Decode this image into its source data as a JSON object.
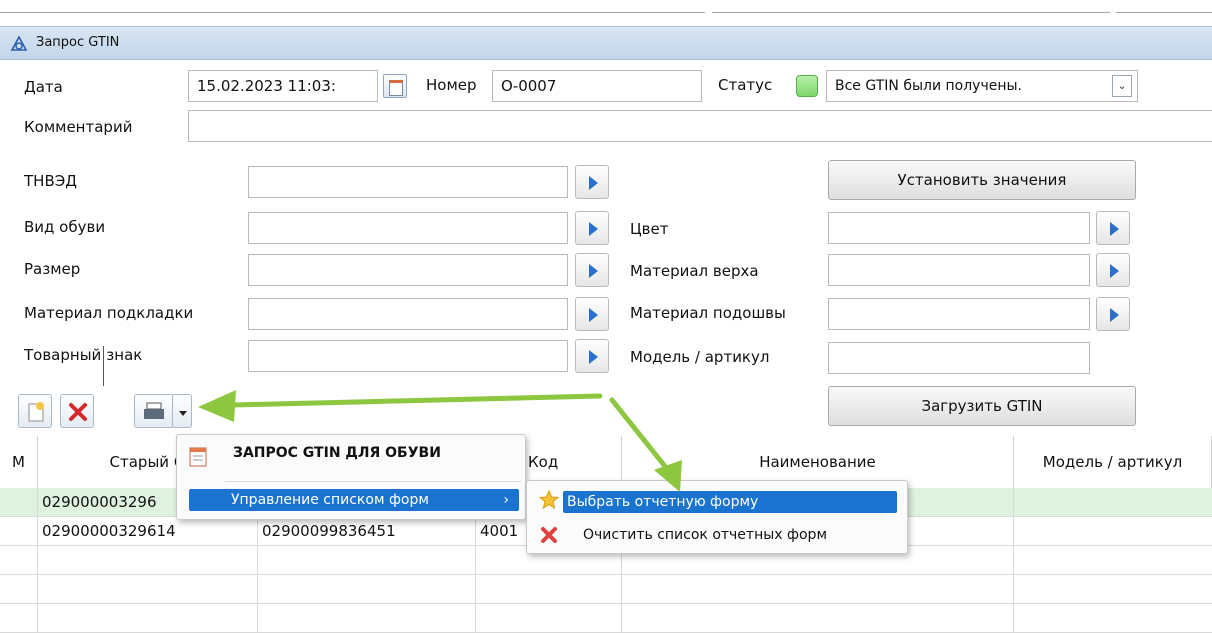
{
  "window": {
    "title": "Запрос GTIN"
  },
  "form": {
    "date_label": "Дата",
    "date_value": "15.02.2023 11:03:",
    "number_label": "Номер",
    "number_value": "О-0007",
    "status_label": "Статус",
    "status_value": "Все GTIN были получены.",
    "comment_label": "Комментарий",
    "comment_value": ""
  },
  "fields": {
    "tnved": "ТНВЭД",
    "shoe_type": "Вид обуви",
    "size": "Размер",
    "lining_material": "Материал подкладки",
    "trademark_part1": "Товарный",
    "trademark_part2": "знак",
    "color": "Цвет",
    "upper_material": "Материал верха",
    "sole_material": "Материал подошвы",
    "model_article": "Модель / артикул"
  },
  "buttons": {
    "set_values": "Установить значения",
    "load_gtin": "Загрузить GTIN"
  },
  "table": {
    "headers": [
      "М",
      "Старый G",
      "Код",
      "Наименование",
      "Модель / артикул"
    ],
    "rows": [
      [
        "",
        "029000003296",
        "",
        "",
        ""
      ],
      [
        "",
        "02900000329614",
        "02900099836451",
        "4001",
        ""
      ]
    ]
  },
  "print_menu": {
    "title_item": "ЗАПРОС GTIN ДЛЯ ОБУВИ",
    "manage_item": "Управление списком форм"
  },
  "submenu": {
    "select_item": "Выбрать отчетную форму",
    "clear_item": "Очистить список отчетных форм"
  },
  "colors": {
    "titlebar": "#c8d9ec",
    "highlight": "#1a73cf",
    "arrow": "#8dc63f",
    "selected_row": "#dff1df"
  },
  "icons": [
    "app-icon",
    "calendar-icon",
    "status-indicator",
    "dropdown-icon",
    "arrow-right-icon",
    "new-doc-icon",
    "delete-icon",
    "printer-icon",
    "star-icon",
    "clear-icon"
  ]
}
